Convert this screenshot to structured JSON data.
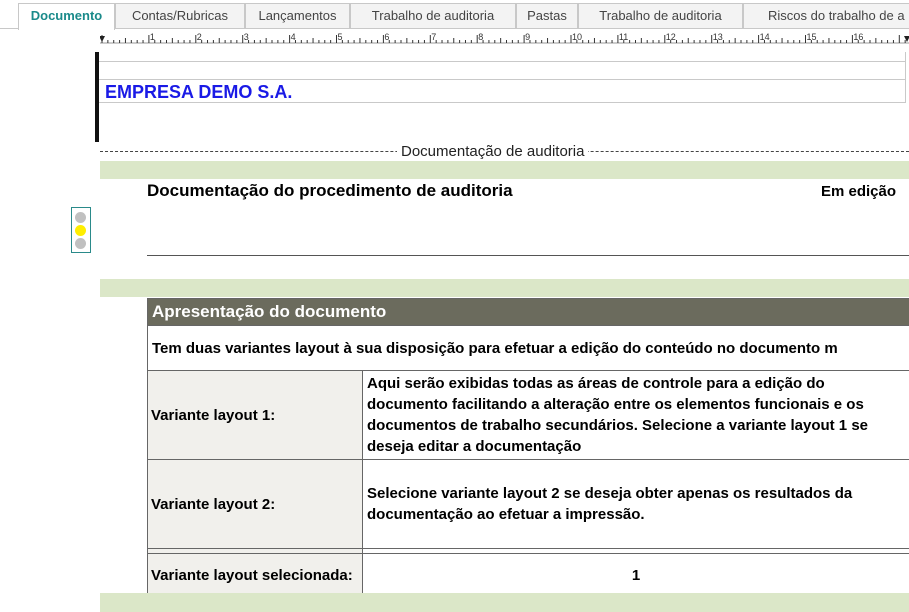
{
  "tabs": [
    {
      "label": "Documento",
      "active": true
    },
    {
      "label": "Contas/Rubricas",
      "active": false
    },
    {
      "label": "Lançamentos",
      "active": false
    },
    {
      "label": "Trabalho de auditoria",
      "active": false
    },
    {
      "label": "Pastas",
      "active": false
    },
    {
      "label": "Trabalho de auditoria",
      "active": false
    },
    {
      "label": "Riscos do trabalho de a",
      "active": false
    }
  ],
  "ruler": {
    "numbers": [
      "1",
      "2",
      "3",
      "4",
      "5",
      "6",
      "7",
      "8",
      "9",
      "10",
      "11",
      "12",
      "13",
      "14",
      "15",
      "16"
    ]
  },
  "header": {
    "company": "EMPRESA DEMO S.A."
  },
  "section": {
    "title": "Documentação de auditoria"
  },
  "procedure": {
    "title": "Documentação do procedimento de auditoria",
    "status": "Em edição",
    "traffic_light": {
      "top": "#c0c0c0",
      "middle": "#ffee00",
      "bottom": "#c0c0c0"
    }
  },
  "presentation": {
    "heading": "Apresentação do documento",
    "intro": "Tem duas variantes layout à sua disposição para efetuar a edição do conteúdo no documento m",
    "rows": [
      {
        "label": "Variante layout 1:",
        "desc": "Aqui serão exibidas todas as áreas de controle para a edição do documento facilitando a alteração entre os elementos funcionais e os documentos de trabalho secundários. Selecione a variante layout 1 se deseja editar a documentação"
      },
      {
        "label": "Variante layout 2:",
        "desc": "Selecione variante layout 2 se deseja obter apenas os resultados da documentação ao efetuar a impressão."
      }
    ],
    "selected_label": "Variante layout selecionada:",
    "selected_value": "1"
  },
  "colors": {
    "accent": "#1a8a8a",
    "company": "#1a1ae6",
    "band": "#dbe7c8",
    "table_header": "#6b6b5d"
  }
}
